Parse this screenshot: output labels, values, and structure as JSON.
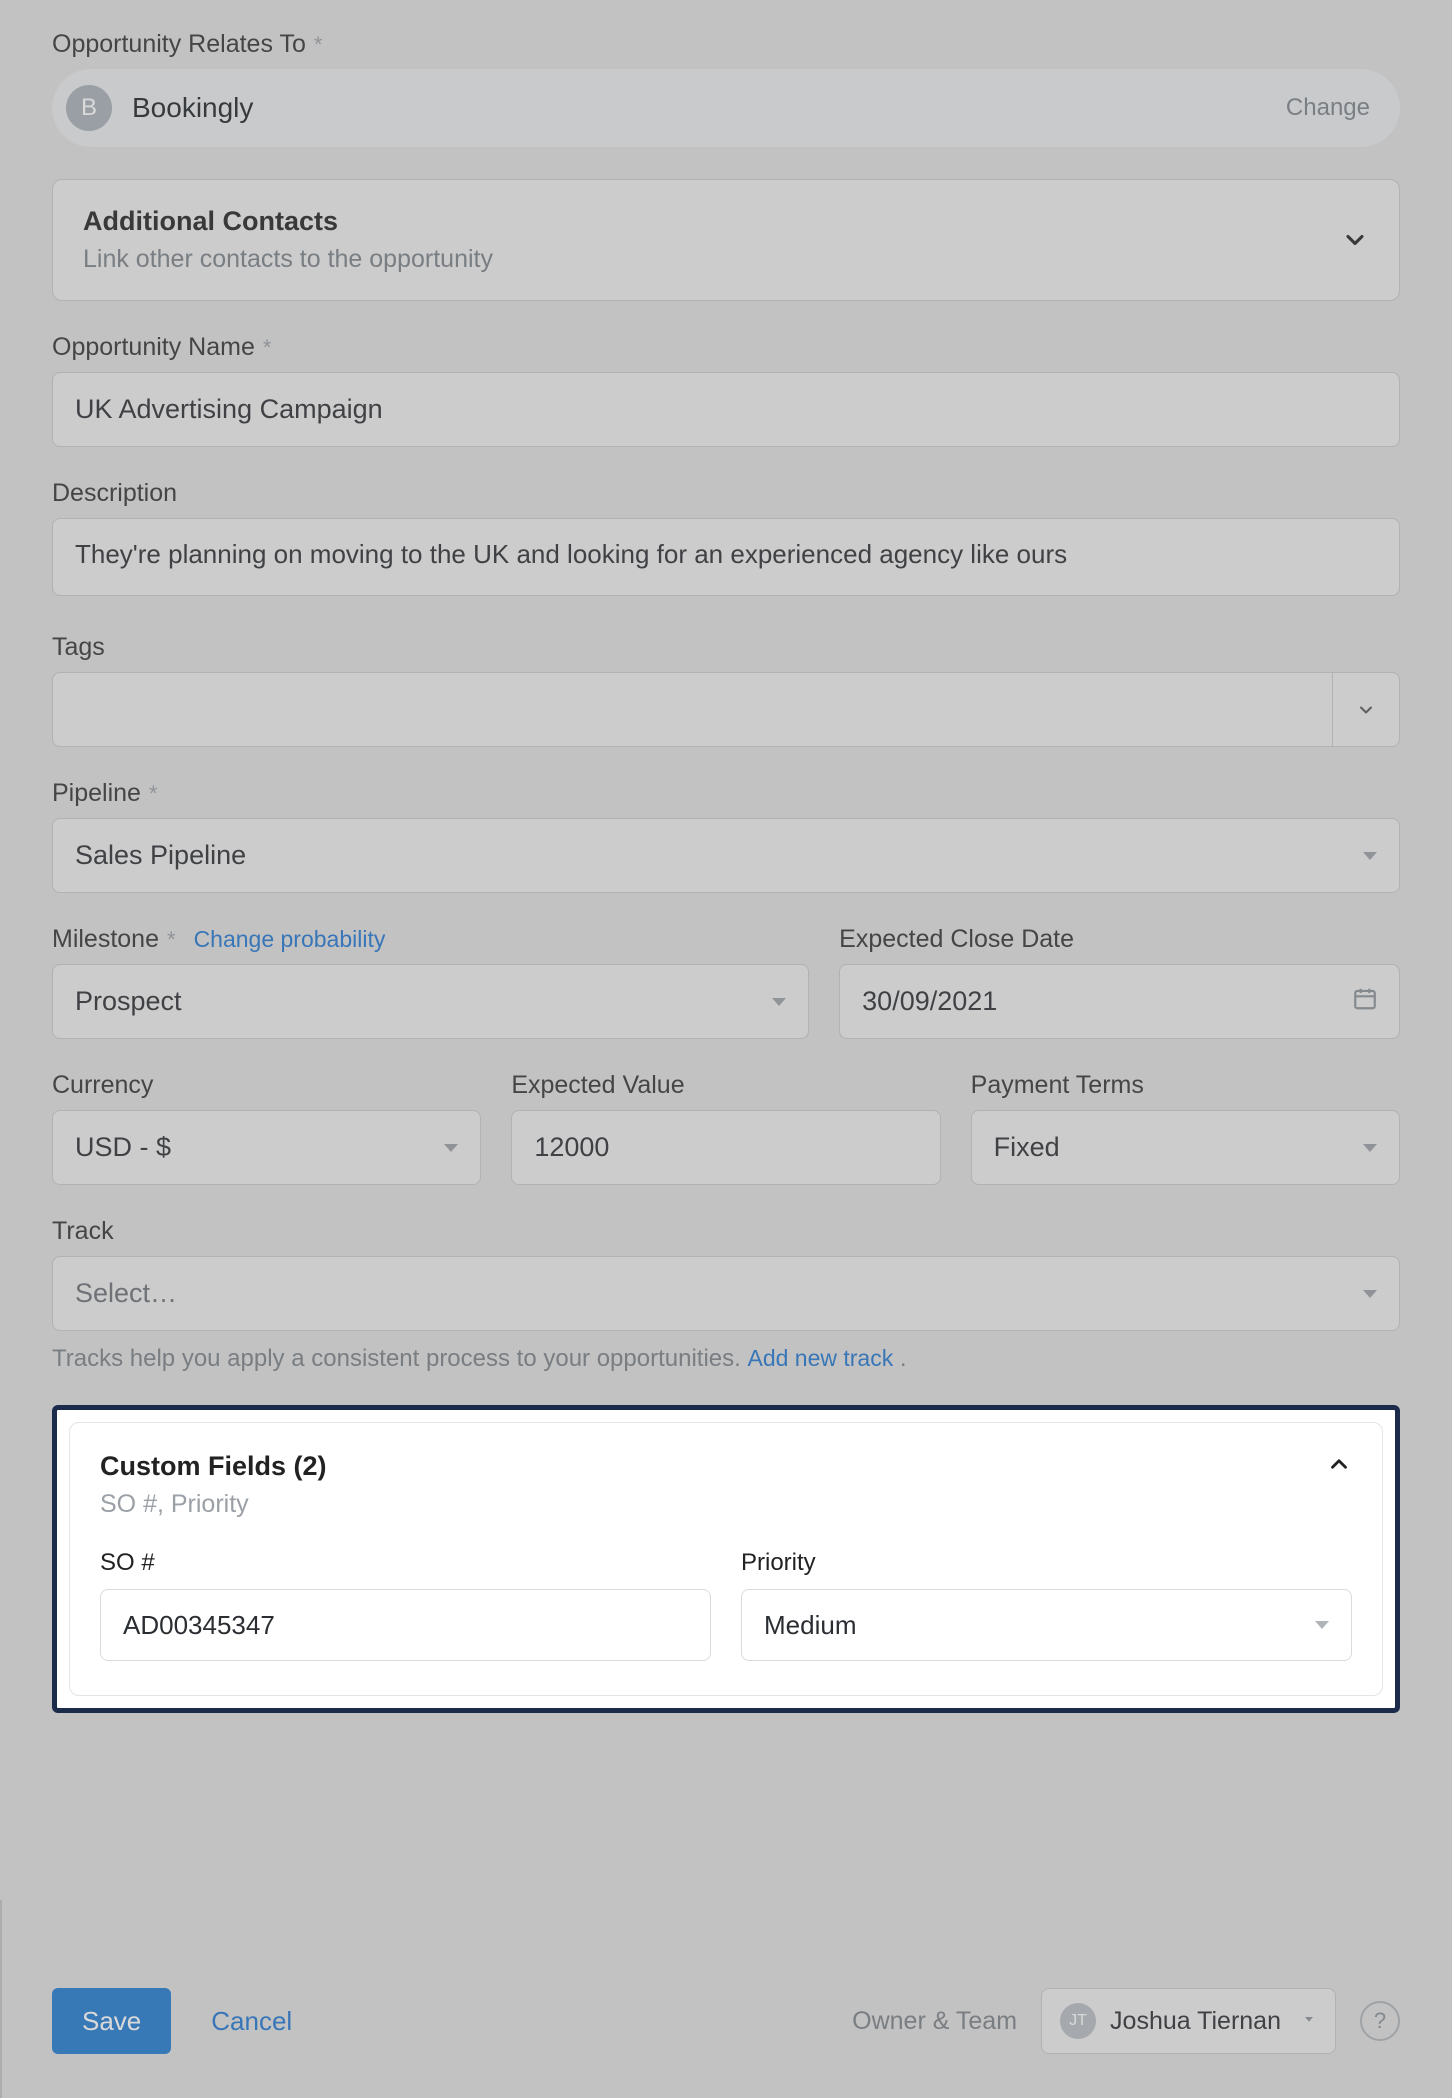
{
  "relatesTo": {
    "label": "Opportunity Relates To",
    "entityInitial": "B",
    "entityName": "Bookingly",
    "changeLabel": "Change"
  },
  "additionalContacts": {
    "title": "Additional Contacts",
    "subtitle": "Link other contacts to the opportunity"
  },
  "opportunityName": {
    "label": "Opportunity Name",
    "value": "UK Advertising Campaign"
  },
  "description": {
    "label": "Description",
    "value": "They're planning on moving to the UK and looking for an experienced agency like ours"
  },
  "tags": {
    "label": "Tags"
  },
  "pipeline": {
    "label": "Pipeline",
    "value": "Sales Pipeline"
  },
  "milestone": {
    "label": "Milestone",
    "changeProbLabel": "Change probability",
    "value": "Prospect"
  },
  "expectedCloseDate": {
    "label": "Expected Close Date",
    "value": "30/09/2021"
  },
  "currency": {
    "label": "Currency",
    "value": "USD - $"
  },
  "expectedValue": {
    "label": "Expected Value",
    "value": "12000"
  },
  "paymentTerms": {
    "label": "Payment Terms",
    "value": "Fixed"
  },
  "track": {
    "label": "Track",
    "placeholder": "Select…",
    "helpText": "Tracks help you apply a consistent process to your opportunities. ",
    "addLink": "Add new track",
    "period": " ."
  },
  "customFields": {
    "title": "Custom Fields (2)",
    "subtitle": "SO #, Priority",
    "so": {
      "label": "SO #",
      "value": "AD00345347"
    },
    "priority": {
      "label": "Priority",
      "value": "Medium"
    }
  },
  "footer": {
    "save": "Save",
    "cancel": "Cancel",
    "ownerLabel": "Owner & Team",
    "ownerInitials": "JT",
    "ownerName": "Joshua Tiernan"
  }
}
